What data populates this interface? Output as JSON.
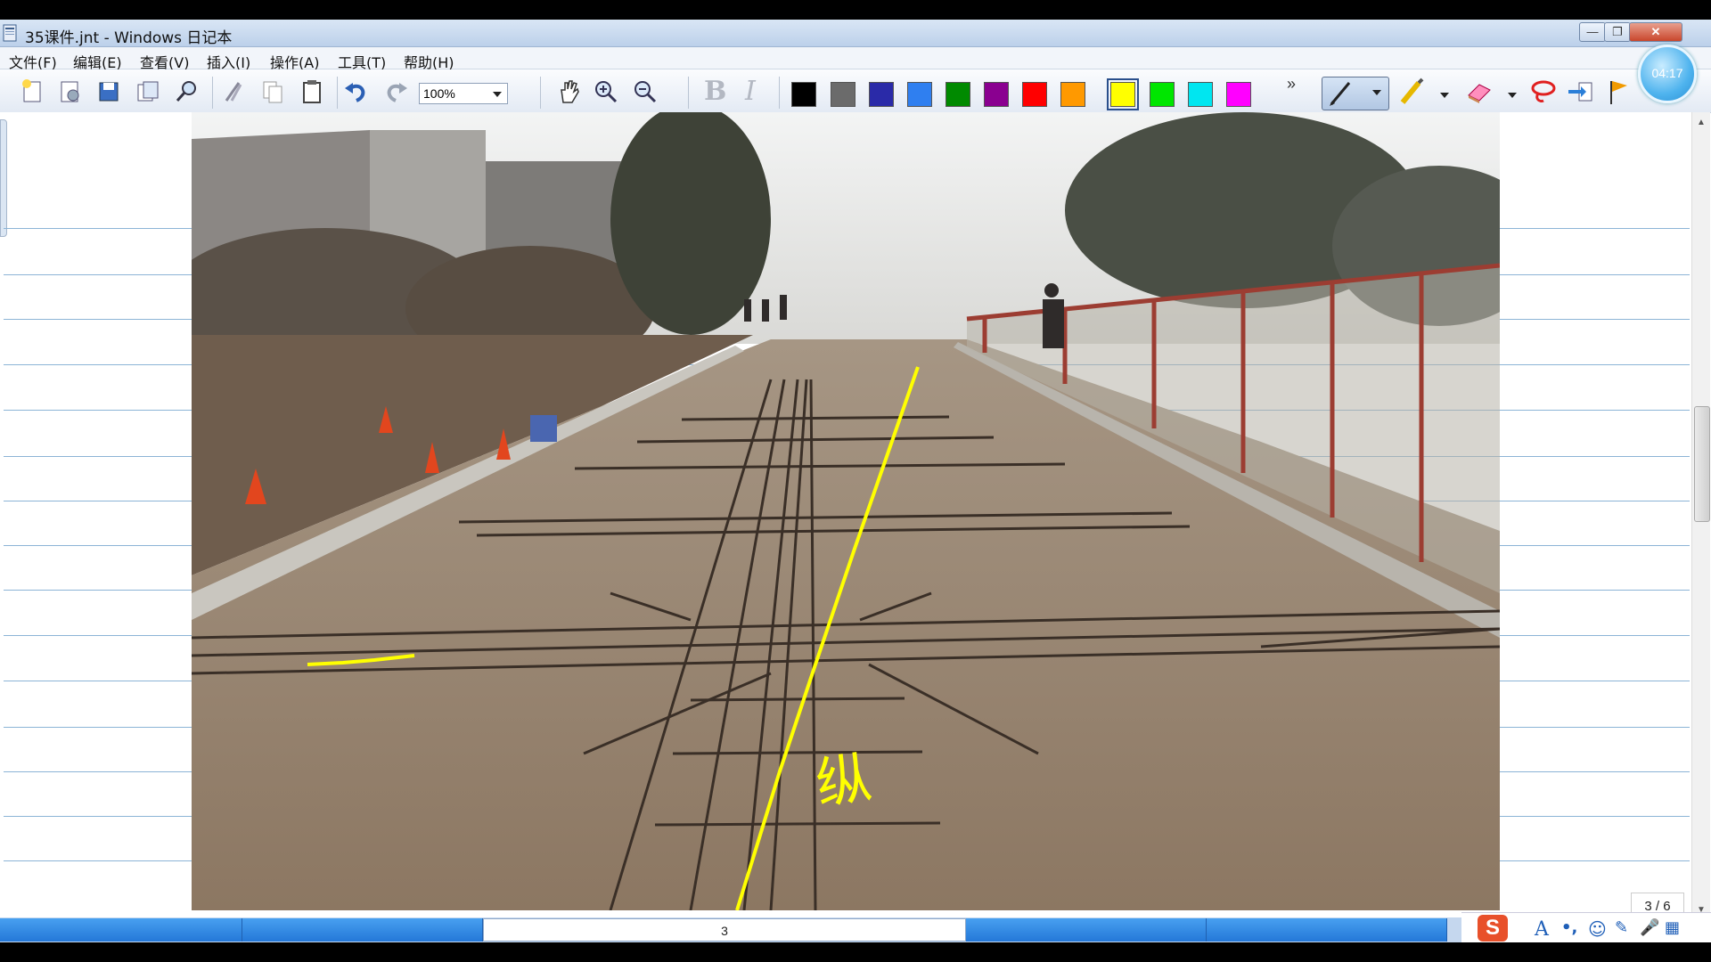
{
  "window": {
    "title": "35课件.jnt - Windows 日记本",
    "min_label": "—",
    "max_label": "❐",
    "close_label": "✕"
  },
  "clock": {
    "time": "04:17"
  },
  "menu": {
    "items": [
      "文件(F)",
      "编辑(E)",
      "查看(V)",
      "插入(I)",
      "操作(A)",
      "工具(T)",
      "帮助(H)"
    ]
  },
  "toolbar": {
    "zoom_value": "100%",
    "buttons": [
      "new-page-icon",
      "new-note-icon",
      "save-icon",
      "import-icon",
      "find-icon",
      "cut-icon",
      "copy-icon",
      "paste-icon",
      "undo-icon",
      "redo-icon",
      "hand-icon",
      "zoom-in-icon",
      "zoom-out-icon",
      "bold-icon",
      "italic-icon"
    ],
    "colors": [
      "#000000",
      "#6b6b6b",
      "#2a2aa8",
      "#2f7ff0",
      "#008a00",
      "#8a0090",
      "#ff0000",
      "#ff9900",
      "#ffff00",
      "#00e600",
      "#00e6f0",
      "#ff00ff"
    ],
    "selected_color": "#ffff00",
    "overflow_label": "»"
  },
  "annotation": {
    "handwritten_text": "纵",
    "ink_color": "#ffff00"
  },
  "page": {
    "counter": "3 / 6",
    "current_tab": "3"
  },
  "ime": {
    "logo": "S"
  }
}
